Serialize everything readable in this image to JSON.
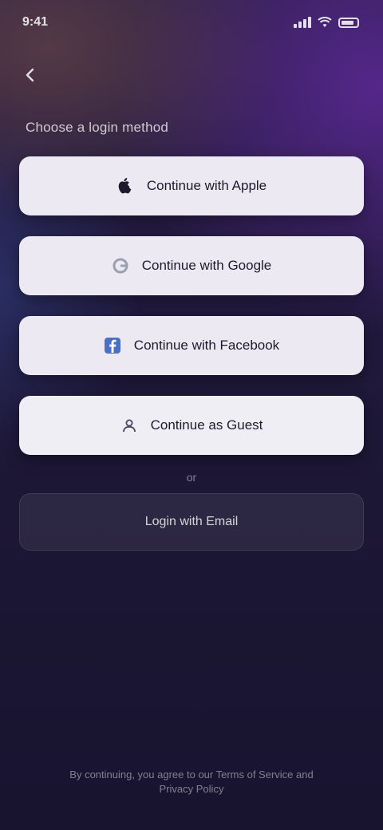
{
  "status_bar": {
    "time": "9:41"
  },
  "header": {
    "back_icon": "arrow-left-icon",
    "section_title": "Choose a login method"
  },
  "login_options": [
    {
      "label": "Continue with Apple",
      "icon": "apple-icon"
    },
    {
      "label": "Continue with Google",
      "icon": "google-icon"
    },
    {
      "label": "Continue with Facebook",
      "icon": "facebook-icon"
    },
    {
      "label": "Continue as Guest",
      "icon": "guest-icon"
    }
  ],
  "divider_text": "or",
  "email_button_label": "Login with Email",
  "footer_text": "By continuing, you agree to our Terms of Service and Privacy Policy",
  "colors": {
    "button_bg": "#ece9f3",
    "button_text": "#1e1a2e",
    "background": "#1c1734",
    "accent": "#5c2896"
  }
}
